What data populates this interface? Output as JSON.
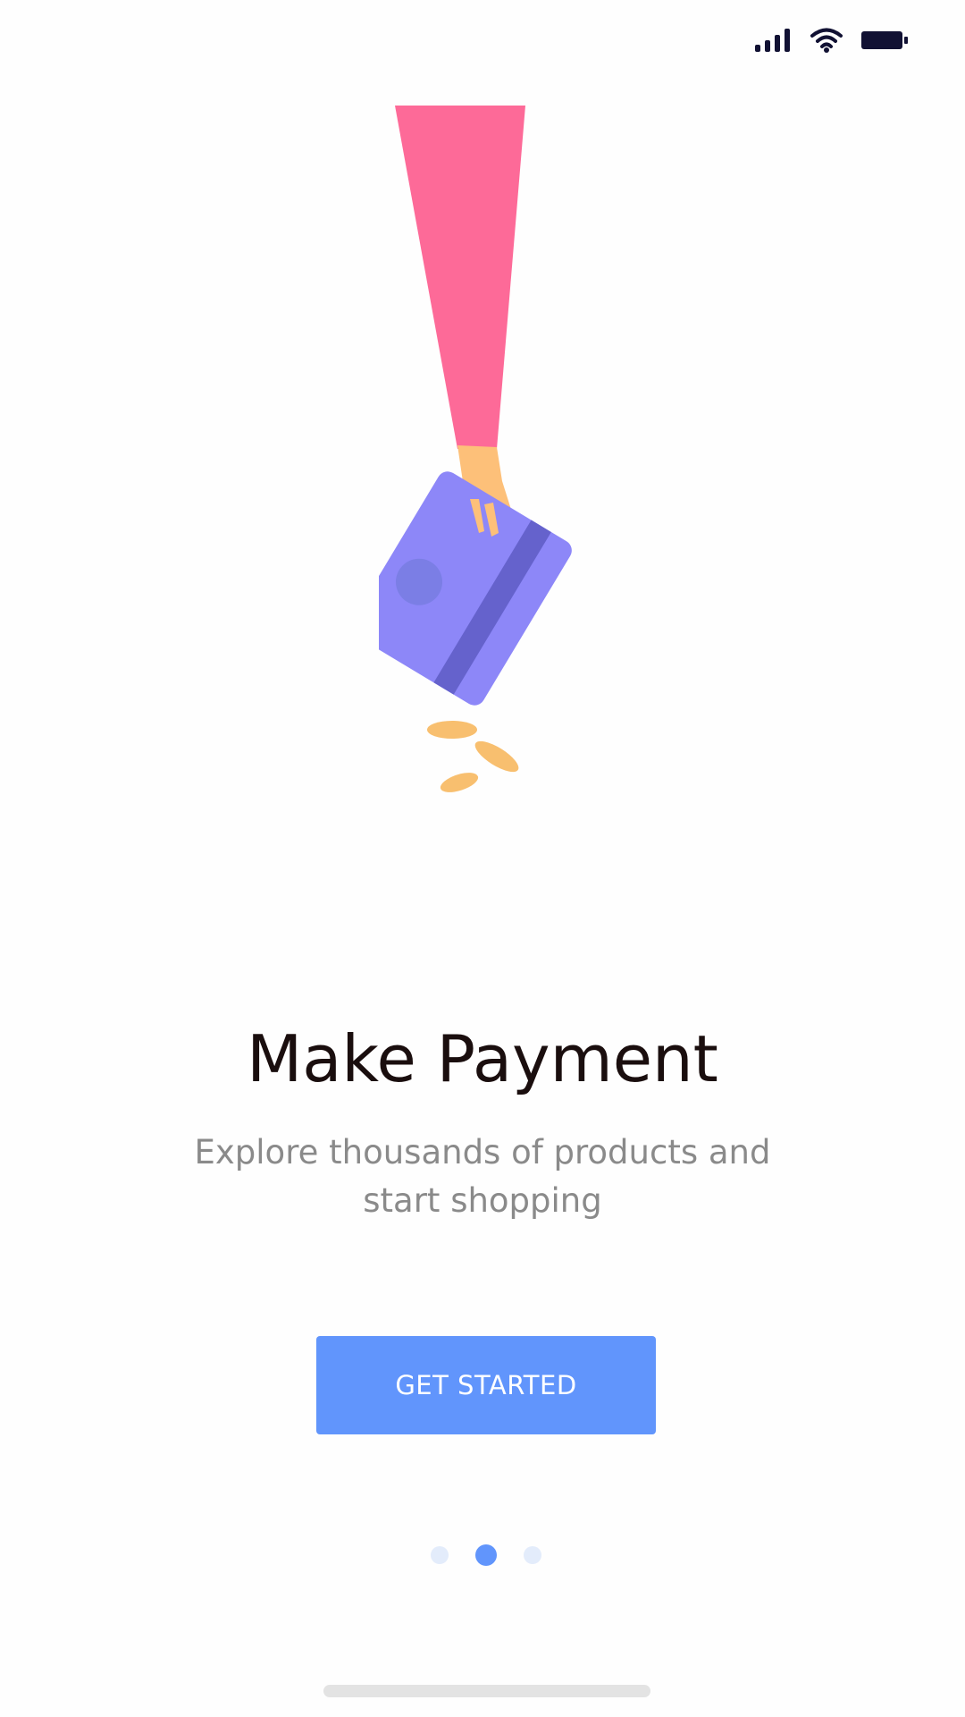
{
  "status_bar": {
    "icons": [
      "signal-icon",
      "wifi-icon",
      "battery-icon"
    ]
  },
  "illustration": {
    "description_icon": "payment-card-illustration",
    "colors": {
      "sleeve": "#fd6a98",
      "hand": "#fdc079",
      "card": "#8d87f8",
      "card_stripe": "#6562cc",
      "card_chip": "#7b7ee5",
      "coins": "#f8bf6f"
    }
  },
  "onboarding": {
    "title": "Make Payment",
    "subtitle": "Explore thousands of products and start shopping",
    "cta_label": "GET STARTED"
  },
  "page_indicator": {
    "total": 3,
    "current": 2
  },
  "colors": {
    "accent": "#6195fc",
    "title_text": "#1a0e0e",
    "subtitle_text": "#8a8a8a",
    "dot_inactive": "#e3ecfb",
    "status_icons": "#111133"
  }
}
